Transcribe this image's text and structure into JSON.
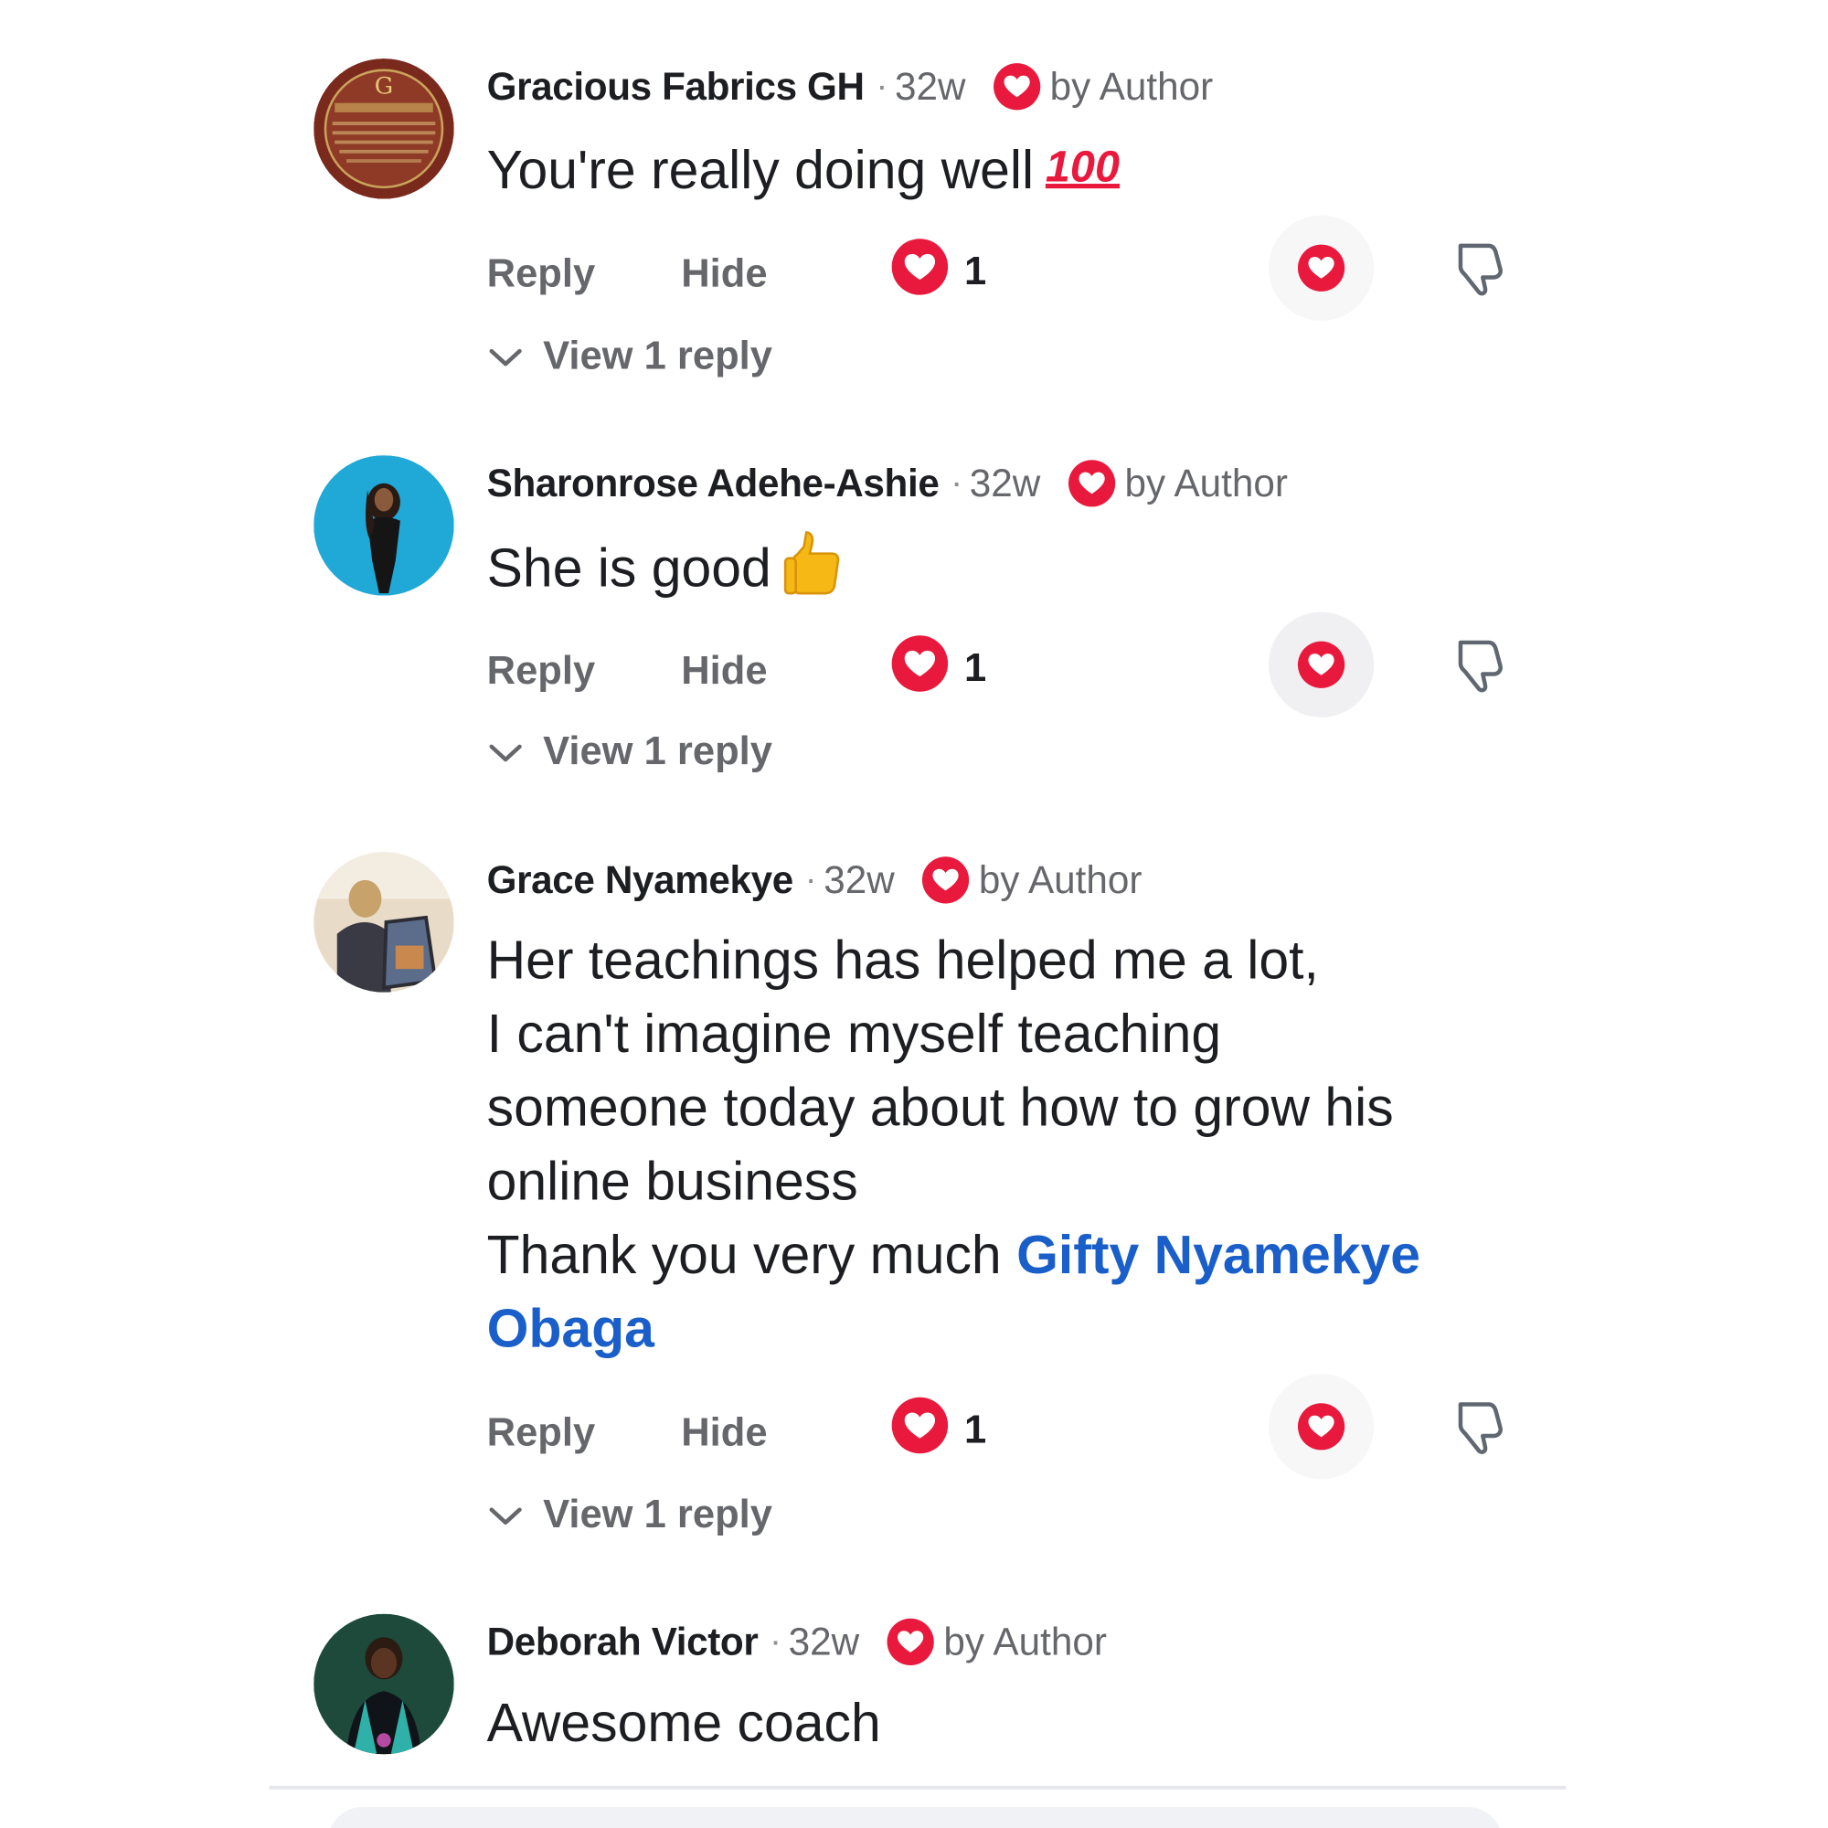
{
  "comments": [
    {
      "name": "Gracious Fabrics GH",
      "time": "32w",
      "author_reaction": "by Author",
      "body": [
        "You're really doing well"
      ],
      "emoji": "100",
      "actions": {
        "reply": "Reply",
        "hide": "Hide"
      },
      "reaction_count": "1",
      "view_replies": "View 1 reply"
    },
    {
      "name": "Sharonrose Adehe-Ashie",
      "time": "32w",
      "author_reaction": "by Author",
      "body": [
        "She is good"
      ],
      "emoji": "thumbs-up",
      "actions": {
        "reply": "Reply",
        "hide": "Hide"
      },
      "reaction_count": "1",
      "view_replies": "View 1 reply"
    },
    {
      "name": "Grace Nyamekye",
      "time": "32w",
      "author_reaction": "by Author",
      "body": [
        "Her teachings has helped me a lot,",
        "I can't imagine myself teaching",
        "someone today about how to grow his",
        "online business",
        "Thank you very much "
      ],
      "mention_line1": "Gifty Nyamekye",
      "mention_line2": "Obaga",
      "actions": {
        "reply": "Reply",
        "hide": "Hide"
      },
      "reaction_count": "1",
      "view_replies": "View 1 reply"
    },
    {
      "name": "Deborah Victor",
      "time": "32w",
      "author_reaction": "by Author",
      "body": [
        "Awesome coach"
      ]
    }
  ],
  "separator": "·",
  "colors": {
    "heart_red": "#e8193c",
    "mention_blue": "#1a5fc9",
    "muted_text": "#65676b"
  },
  "icons": {
    "author_like": "heart-icon",
    "reaction": "heart-icon",
    "like": "heart-icon",
    "dislike": "thumbs-down-icon",
    "expand": "chevron-down-icon"
  }
}
